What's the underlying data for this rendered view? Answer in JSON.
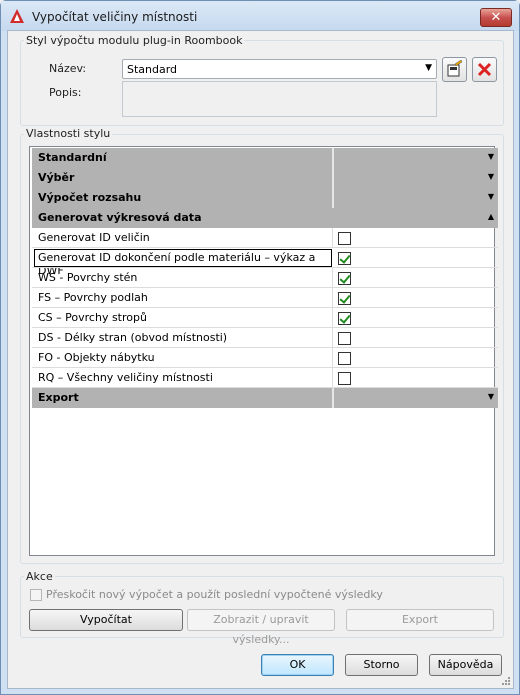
{
  "window": {
    "title": "Vypočítat veličiny místnosti",
    "close_label": "✕"
  },
  "style_group": {
    "label": "Styl výpočtu modulu plug-in Roombook",
    "name_label": "Název:",
    "name_value": "Standard",
    "desc_label": "Popis:",
    "desc_value": ""
  },
  "props_group": {
    "label": "Vlastnosti stylu",
    "categories": [
      {
        "name": "Standardní",
        "expanded": false
      },
      {
        "name": "Výběr",
        "expanded": false
      },
      {
        "name": "Výpočet rozsahu",
        "expanded": false
      },
      {
        "name": "Generovat výkresová data",
        "expanded": true
      },
      {
        "name": "Export",
        "expanded": false
      }
    ],
    "properties": [
      {
        "name": "Generovat ID veličin",
        "checked": false
      },
      {
        "name": "Generovat ID dokončení podle materiálu – výkaz a DWF",
        "checked": true
      },
      {
        "name": "WS - Povrchy stén",
        "checked": true
      },
      {
        "name": "FS – Povrchy podlah",
        "checked": true
      },
      {
        "name": "CS – Povrchy stropů",
        "checked": true
      },
      {
        "name": "DS - Délky stran (obvod místnosti)",
        "checked": false
      },
      {
        "name": "FO - Objekty nábytku",
        "checked": false
      },
      {
        "name": "RQ – Všechny veličiny místnosti",
        "checked": false
      }
    ]
  },
  "actions_group": {
    "label": "Akce",
    "skip_label": "Přeskočit nový výpočet a použít poslední vypočtené výsledky",
    "calculate": "Vypočítat",
    "view_edit": "Zobrazit / upravit výsledky...",
    "export": "Export"
  },
  "footer": {
    "ok": "OK",
    "cancel": "Storno",
    "help": "Nápověda"
  },
  "colors": {
    "category_bg": "#b2b2b2",
    "check_color": "#228b22",
    "close_red": "#c75050"
  }
}
